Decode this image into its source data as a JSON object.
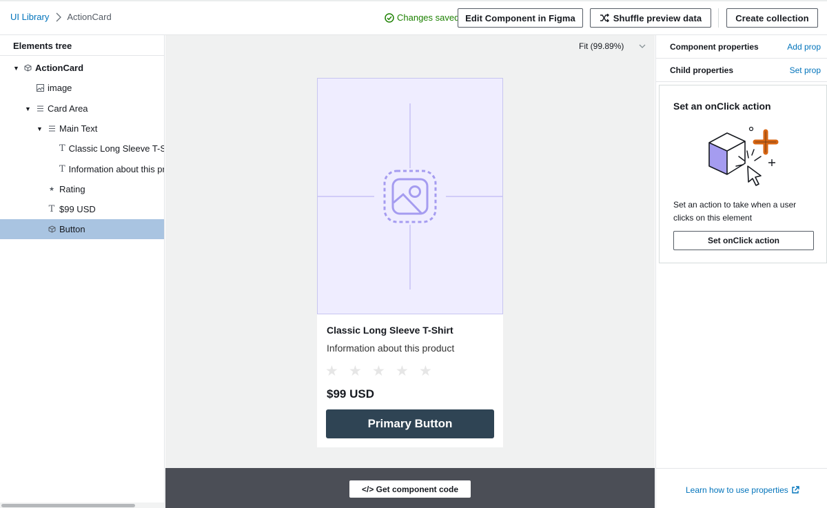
{
  "header": {
    "breadcrumbs": [
      "UI Library",
      "ActionCard"
    ],
    "status": "Changes saved",
    "edit_figma_label": "Edit Component in Figma",
    "shuffle_label": "Shuffle preview data",
    "create_collection_label": "Create collection"
  },
  "elements_tree": {
    "title": "Elements tree",
    "nodes": [
      {
        "label": "ActionCard",
        "icon": "component-icon",
        "expanded": true
      },
      {
        "label": "image",
        "icon": "image-icon"
      },
      {
        "label": "Card Area",
        "icon": "flex-icon",
        "expanded": true
      },
      {
        "label": "Main Text",
        "icon": "flex-icon",
        "expanded": true
      },
      {
        "label": "Classic Long Sleeve T-Shirt",
        "icon": "text-icon"
      },
      {
        "label": "Information about this product",
        "icon": "text-icon"
      },
      {
        "label": "Rating",
        "icon": "star-icon"
      },
      {
        "label": "$99 USD",
        "icon": "text-icon"
      },
      {
        "label": "Button",
        "icon": "component-icon",
        "selected": true
      }
    ]
  },
  "canvas": {
    "zoom": "Fit (99.89%)",
    "card": {
      "title": "Classic Long Sleeve T-Shirt",
      "description": "Information about this product",
      "rating": 0,
      "rating_max": 5,
      "price": "$99 USD",
      "button_label": "Primary Button"
    },
    "get_code_label": "</> Get component code"
  },
  "right_panel": {
    "component_properties": "Component properties",
    "add_prop": "Add prop",
    "child_properties": "Child properties",
    "set_prop": "Set prop",
    "onclick_title": "Set an onClick action",
    "onclick_description": "Set an action to take when a user clicks on this element",
    "onclick_button": "Set onClick action",
    "learn_link": "Learn how to use properties"
  },
  "colors": {
    "link": "#0073bb",
    "success": "#1d8102",
    "selected_row": "#a9c4e1",
    "primary_button": "#2f4454",
    "placeholder_bg": "#efedff",
    "placeholder_accent": "#a59cf0",
    "illustration_orange": "#d86613",
    "illustration_purple": "#a59cf0"
  }
}
